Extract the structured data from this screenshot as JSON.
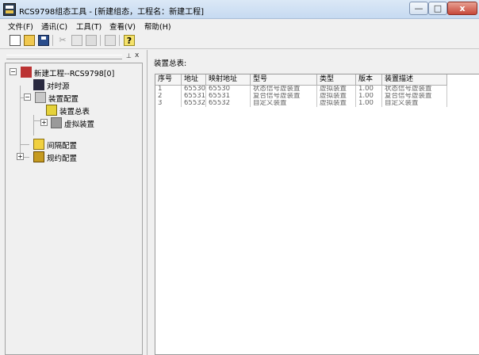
{
  "window": {
    "title": "RCS9798组态工具 - [新建组态，工程名：新建工程]",
    "min_glyph": "—",
    "max_glyph": "□",
    "close_glyph": "x"
  },
  "menu": [
    "文件(F)",
    "通讯(C)",
    "工具(T)",
    "查看(V)",
    "帮助(H)"
  ],
  "toolbar": {
    "icons": [
      "new-file-icon",
      "open-folder-icon",
      "save-icon",
      "cut-icon",
      "copy-icon",
      "paste-icon",
      "print-icon",
      "help-icon"
    ],
    "cut_glyph": "✂",
    "help_glyph": "?"
  },
  "leftpane": {
    "pin_glyph": "⊥",
    "close_glyph": "x"
  },
  "tree": {
    "root": "新建工程--RCS9798[0]",
    "items": [
      {
        "label": "对时源"
      },
      {
        "label": "装置配置"
      },
      {
        "label": "装置总表"
      },
      {
        "label": "虚拟装置"
      },
      {
        "label": "间隔配置"
      },
      {
        "label": "规约配置"
      }
    ]
  },
  "panel": {
    "label": "装置总表:"
  },
  "table": {
    "columns": [
      "序号",
      "地址",
      "映射地址",
      "型号",
      "类型",
      "版本",
      "装置描述"
    ],
    "rows": [
      [
        "1",
        "65530",
        "65530",
        "状态信号虚装置",
        "虚拟装置",
        "1.00",
        "状态信号虚装置"
      ],
      [
        "2",
        "65531",
        "65531",
        "复合信号虚装置",
        "虚拟装置",
        "1.00",
        "复合信号虚装置"
      ],
      [
        "3",
        "65532",
        "65532",
        "自定义装置",
        "虚拟装置",
        "1.00",
        "自定义装置"
      ]
    ]
  },
  "colors": {
    "titlebar": "#c6daf1",
    "close_button": "#c7483a",
    "window_bg": "#f0f0f0",
    "list_text": "#606060"
  }
}
